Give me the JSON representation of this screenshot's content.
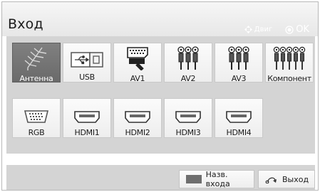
{
  "header": {
    "title": "Вход",
    "hint_move": "Двиг",
    "hint_ok": "OK"
  },
  "inputs": [
    {
      "label": "Антенна",
      "icon": "antenna-icon",
      "selected": true
    },
    {
      "label": "USB",
      "icon": "usb-icon",
      "selected": false
    },
    {
      "label": "AV1",
      "icon": "scart-icon",
      "selected": false
    },
    {
      "label": "AV2",
      "icon": "rca-av-icon",
      "selected": false
    },
    {
      "label": "AV3",
      "icon": "rca-av-icon",
      "selected": false
    },
    {
      "label": "Компонент",
      "icon": "component-icon",
      "selected": false
    },
    {
      "label": "RGB",
      "icon": "vga-icon",
      "selected": false
    },
    {
      "label": "HDMI1",
      "icon": "hdmi-icon",
      "selected": false
    },
    {
      "label": "HDMI2",
      "icon": "hdmi-icon",
      "selected": false
    },
    {
      "label": "HDMI3",
      "icon": "hdmi-icon",
      "selected": false
    },
    {
      "label": "HDMI4",
      "icon": "hdmi-icon",
      "selected": false
    }
  ],
  "footer": {
    "rename_label": "Назв. входа",
    "exit_label": "Выход"
  },
  "colors": {
    "panel": "#d4d4d4",
    "selected_tile": "#767676",
    "rename_swatch": "#6e6e6e"
  }
}
